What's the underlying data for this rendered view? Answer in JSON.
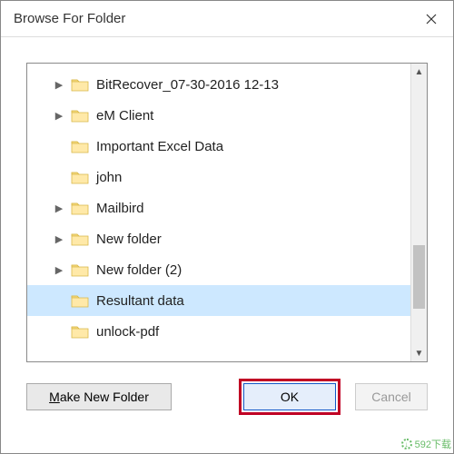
{
  "dialog": {
    "title": "Browse For Folder"
  },
  "tree": {
    "items": [
      {
        "label": "BitRecover_07-30-2016 12-13",
        "expandable": true,
        "selected": false
      },
      {
        "label": "eM Client",
        "expandable": true,
        "selected": false
      },
      {
        "label": "Important Excel Data",
        "expandable": false,
        "selected": false
      },
      {
        "label": "john",
        "expandable": false,
        "selected": false
      },
      {
        "label": "Mailbird",
        "expandable": true,
        "selected": false
      },
      {
        "label": "New folder",
        "expandable": true,
        "selected": false
      },
      {
        "label": "New folder (2)",
        "expandable": true,
        "selected": false
      },
      {
        "label": "Resultant data",
        "expandable": false,
        "selected": true
      },
      {
        "label": "unlock-pdf",
        "expandable": false,
        "selected": false
      }
    ]
  },
  "buttons": {
    "make_new_folder_prefix": "M",
    "make_new_folder_rest": "ake New Folder",
    "ok": "OK",
    "cancel": "Cancel"
  },
  "watermark": {
    "text": "592下载"
  }
}
